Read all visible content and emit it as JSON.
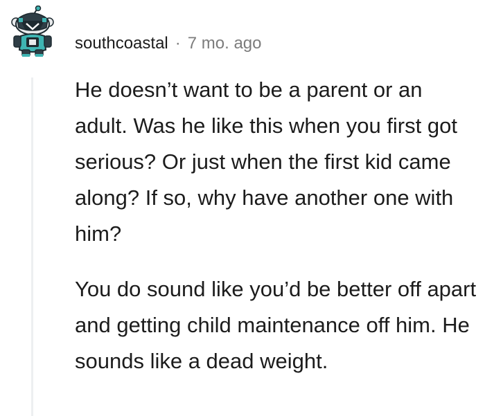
{
  "comment": {
    "author": "southcoastal",
    "separator": "·",
    "timestamp": "7 mo. ago",
    "avatar_icon": "snoo-avatar-icon",
    "paragraphs": [
      "He doesn’t want to be a parent or an adult. Was he like this when you first got serious? Or just when the first kid came along? If so, why have another one with him?",
      "You do sound like you’d be better off apart and getting child maintenance off him. He sounds like a dead weight."
    ]
  },
  "colors": {
    "text": "#1c1c1c",
    "meta_text": "#7c7c7c",
    "thread_line": "#edeff1",
    "avatar_teal": "#3fb5b3",
    "avatar_dark": "#1e2a30"
  }
}
